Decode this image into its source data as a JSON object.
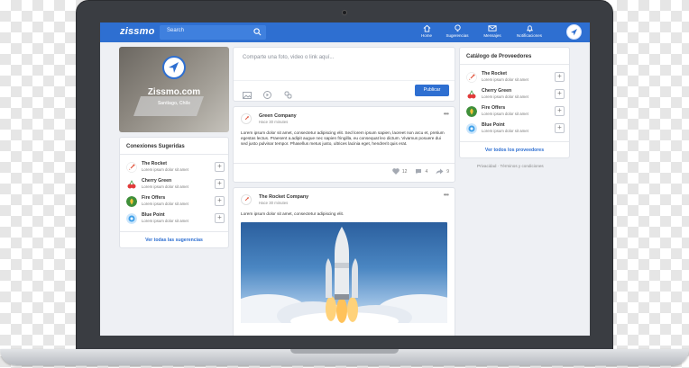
{
  "nav": {
    "logo": "zissmo",
    "search_placeholder": "Search",
    "items": [
      {
        "label": "Home",
        "icon": "home-icon"
      },
      {
        "label": "Sugerencias",
        "icon": "lightbulb-icon"
      },
      {
        "label": "Mensajes",
        "icon": "mail-icon"
      },
      {
        "label": "Notificaciones",
        "icon": "bell-icon"
      }
    ],
    "accent": "#2e6fd1"
  },
  "profile": {
    "name": "Zissmo.com",
    "location": "Santiago, Chile"
  },
  "suggested": {
    "title": "Conexiones Sugeridas",
    "items": [
      {
        "name": "The Rocket",
        "desc": "Lorem ipsum dolor sit amet",
        "icon": "rocket-icon"
      },
      {
        "name": "Cherry Green",
        "desc": "Lorem ipsum dolor sit amet",
        "icon": "cherry-icon"
      },
      {
        "name": "Fire Offers",
        "desc": "Lorem ipsum dolor sit amet",
        "icon": "fire-icon"
      },
      {
        "name": "Blue Point",
        "desc": "Lorem ipsum dolor sit amet",
        "icon": "bluepoint-icon"
      }
    ],
    "see_all": "Ver todas las sugerencias"
  },
  "composer": {
    "placeholder": "Comparte una foto, video o link aquí...",
    "publish_label": "Publicar"
  },
  "posts": [
    {
      "author": "Green Company",
      "time": "Hace 30 minutes",
      "text": "Lorem ipsum dolor sit amet, consectetur adipiscing elit. Sed lorem ipsum sapien, laoreet non arcu et, pretium egestas lectus. Praesent a.adipit augue nec sapien fringilla, eu consequat leo dictum. Vivamus posuere dui sed justo pulvinar tempor. Phasellus metus justo, ultrices lacinia eget, hendrerit quis erat.",
      "likes": "12",
      "comments": "4",
      "shares": "9"
    },
    {
      "author": "The Rocket Company",
      "time": "Hace 30 minutes",
      "text": "Lorem ipsum dolor sit amet, consectetur adipiscing elit."
    }
  ],
  "catalog": {
    "title": "Catálogo de Proveedores",
    "items": [
      {
        "name": "The Rocket",
        "desc": "Lorem ipsum dolor sit amet",
        "icon": "rocket-icon"
      },
      {
        "name": "Cherry Green",
        "desc": "Lorem ipsum dolor sit amet",
        "icon": "cherry-icon"
      },
      {
        "name": "Fire Offers",
        "desc": "Lorem ipsum dolor sit amet",
        "icon": "fire-icon"
      },
      {
        "name": "Blue Point",
        "desc": "Lorem ipsum dolor sit amet",
        "icon": "bluepoint-icon"
      }
    ],
    "see_all": "Ver todos los proveedores"
  },
  "footer": {
    "privacy": "Privacidad",
    "terms": "Términos y condiciones",
    "separator": "·"
  }
}
